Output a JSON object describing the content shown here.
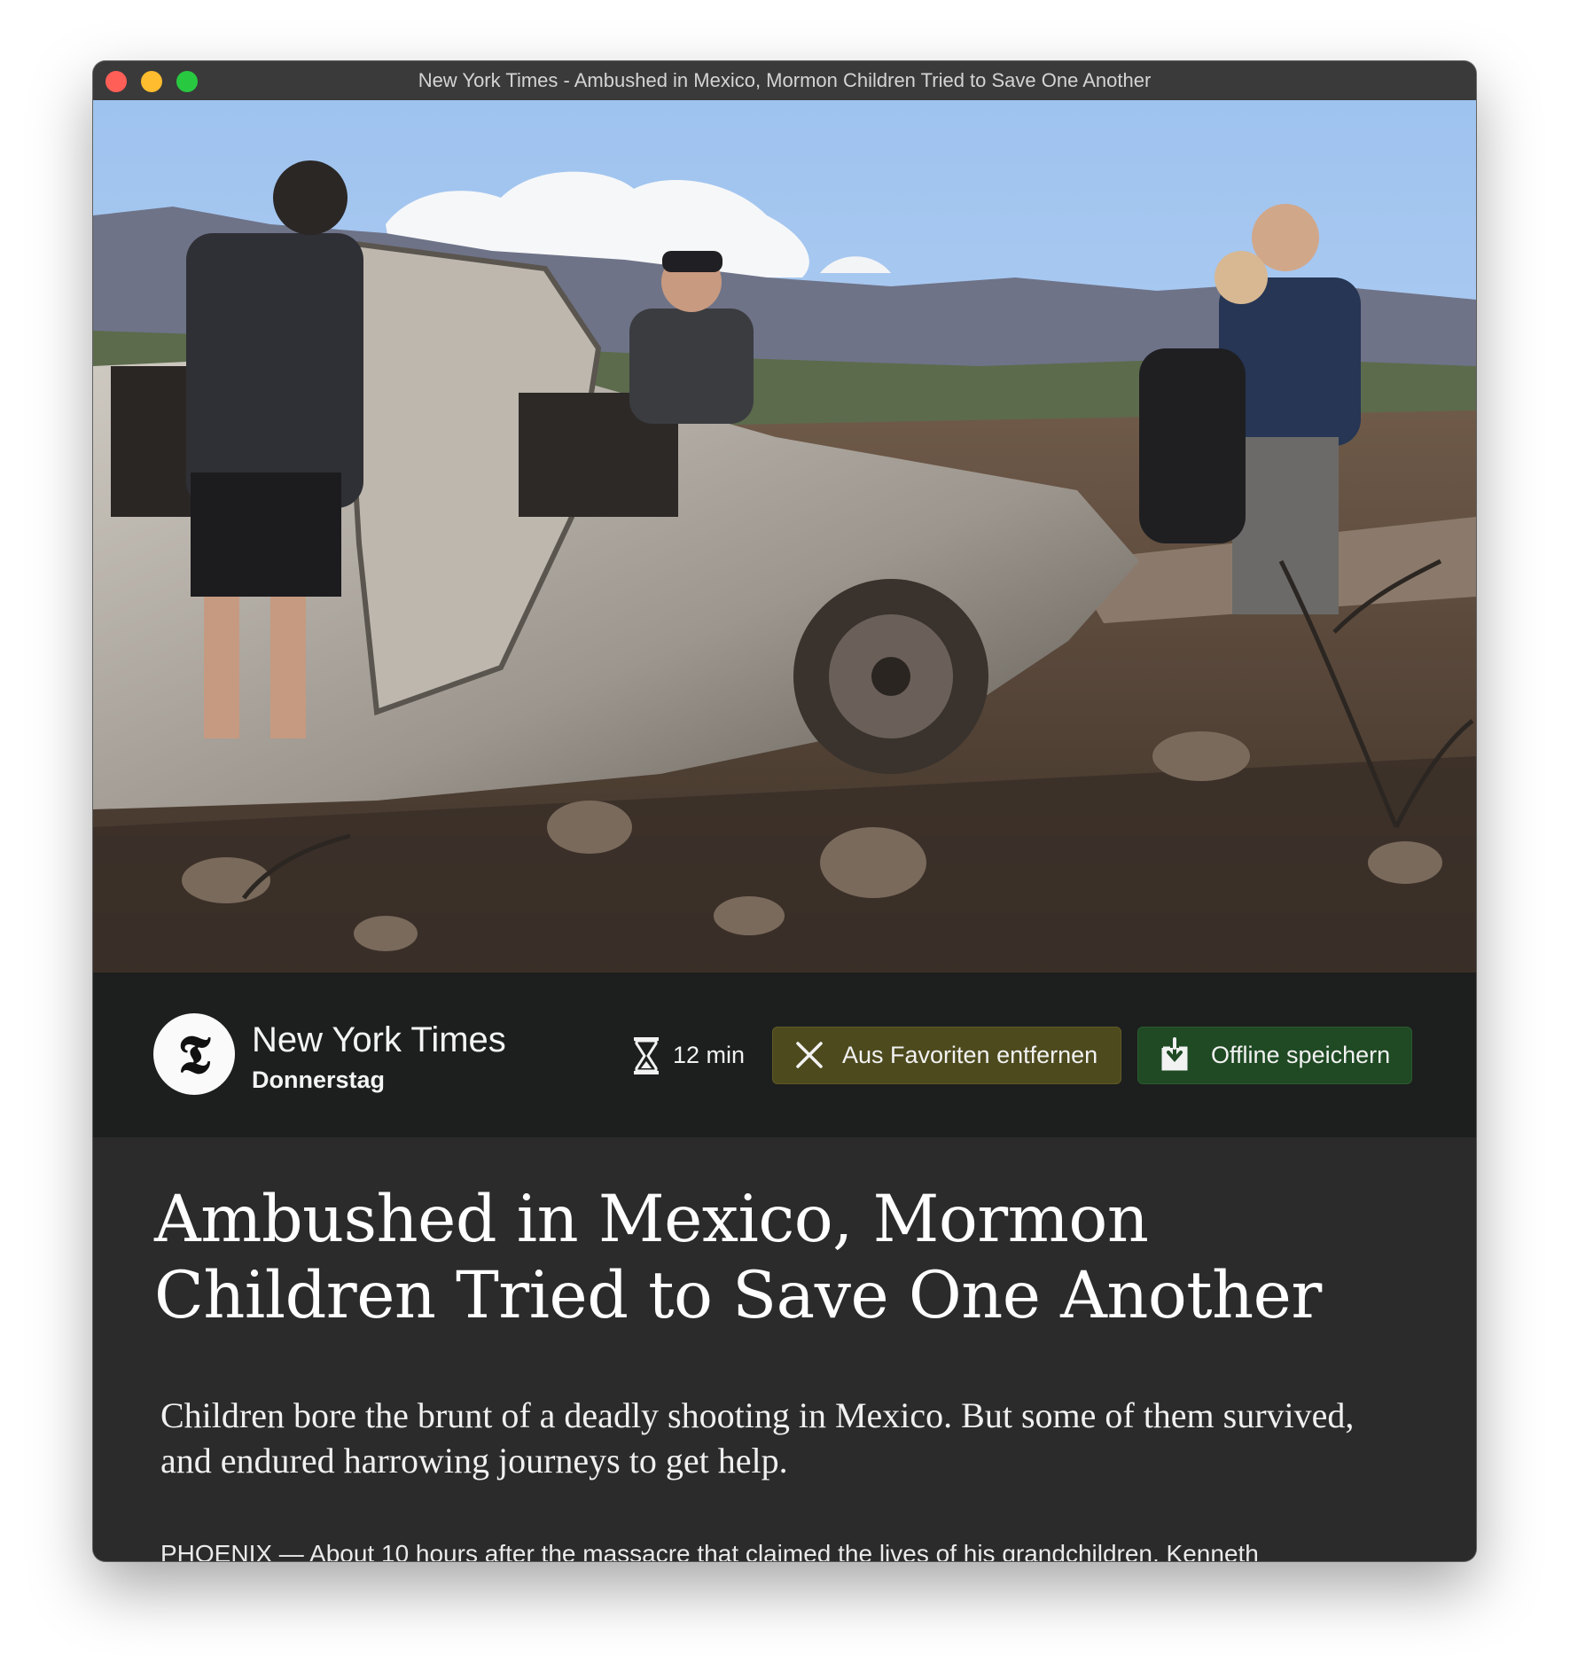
{
  "window": {
    "title": "New York Times - Ambushed in Mexico, Mormon Children Tried to Save One Another"
  },
  "source": {
    "logo_glyph": "𝕿",
    "name": "New York Times",
    "day": "Donnerstag"
  },
  "meta": {
    "read_time": "12 min",
    "favorite_button": "Aus Favoriten entfernen",
    "offline_button": "Offline speichern"
  },
  "article": {
    "headline": "Ambushed in Mexico, Mormon Children Tried to Save One Another",
    "summary": "Children bore the brunt of a deadly shooting in Mexico. But some of them survived, and endured harrowing journeys to get help.",
    "body_first_line": "PHOENIX — About 10 hours after the massacre that claimed the lives of his grandchildren, Kenneth"
  },
  "colors": {
    "favorite_button_bg": "#4d4a1e",
    "offline_button_bg": "#1f4a24",
    "metabar_bg": "#1d1e1e",
    "article_bg": "#2b2b2b"
  },
  "icons": {
    "read_time": "hourglass-icon",
    "favorite": "close-icon",
    "offline": "download-icon"
  }
}
